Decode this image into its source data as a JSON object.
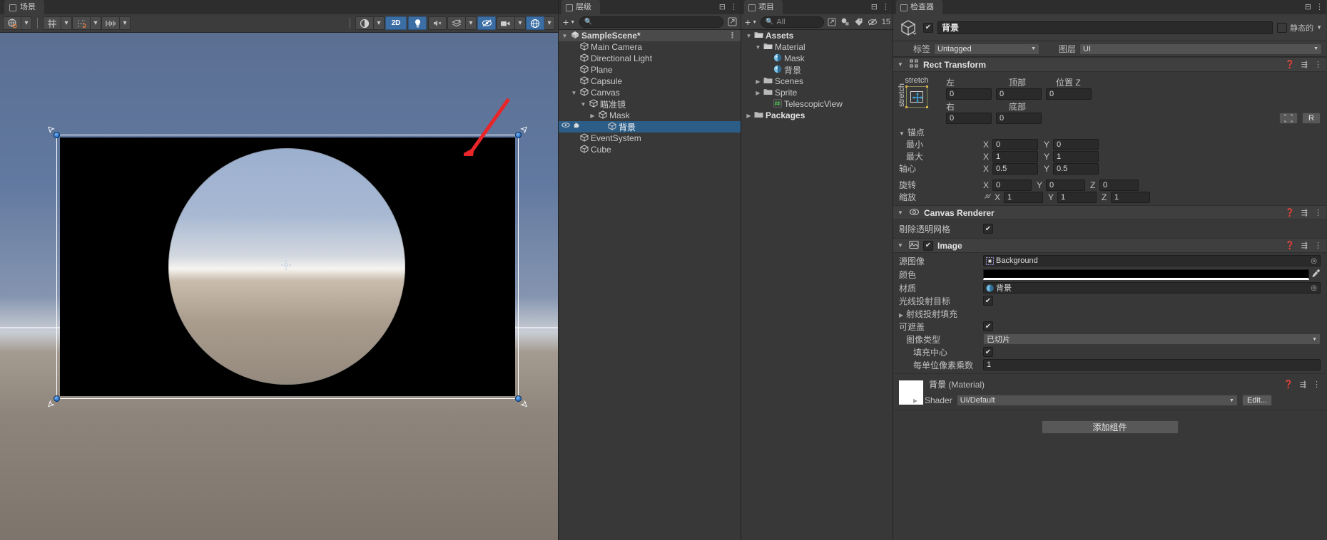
{
  "scene_view": {
    "tab_label": "场景",
    "toolbar_left": [
      {
        "name": "pivot-rotation-toggle",
        "glyph": "◍"
      },
      {
        "name": "pivot-rotation-caret",
        "glyph": "▾"
      },
      {
        "name": "grid-visibility-toggle",
        "glyph": "▦"
      },
      {
        "name": "grid-visibility-caret",
        "glyph": "▾"
      },
      {
        "name": "grid-snapping-toggle",
        "glyph": "⊞"
      },
      {
        "name": "grid-snapping-caret",
        "glyph": "▾"
      },
      {
        "name": "snap-increment-toggle",
        "glyph": "|||||"
      },
      {
        "name": "snap-increment-caret",
        "glyph": "▾"
      }
    ],
    "toolbar_right": [
      {
        "name": "shading-mode-button",
        "glyph": "◑",
        "active": false
      },
      {
        "name": "shading-mode-caret",
        "glyph": "▾",
        "active": false
      },
      {
        "name": "2d-toggle",
        "glyph": "2D",
        "active": true
      },
      {
        "name": "lighting-toggle",
        "glyph": "💡",
        "active": true
      },
      {
        "name": "audio-toggle",
        "glyph": "🔇",
        "active": false
      },
      {
        "name": "fx-toggle",
        "glyph": "≋",
        "active": false
      },
      {
        "name": "fx-caret",
        "glyph": "▾",
        "active": false
      },
      {
        "name": "scene-visibility-toggle",
        "glyph": "👁",
        "active": true
      },
      {
        "name": "camera-settings-button",
        "glyph": "🎥",
        "active": false
      },
      {
        "name": "camera-settings-caret",
        "glyph": "▾",
        "active": false
      },
      {
        "name": "gizmos-toggle",
        "glyph": "◉",
        "active": true
      },
      {
        "name": "gizmos-caret",
        "glyph": "▾",
        "active": false
      }
    ],
    "annotation": "red-arrow-pointing-to-rect-corner"
  },
  "hierarchy": {
    "tab_label": "层级",
    "search_placeholder": "",
    "add_button": "+",
    "scene_row": {
      "label": "SampleScene*",
      "icon": "unity-scene-icon",
      "expanded": true
    },
    "items": [
      {
        "label": "Main Camera",
        "indent": 1,
        "icon": "gameobject-icon",
        "arrow": "",
        "selected": false
      },
      {
        "label": "Directional Light",
        "indent": 1,
        "icon": "gameobject-icon",
        "arrow": "",
        "selected": false
      },
      {
        "label": "Plane",
        "indent": 1,
        "icon": "gameobject-icon",
        "arrow": "",
        "selected": false
      },
      {
        "label": "Capsule",
        "indent": 1,
        "icon": "gameobject-icon",
        "arrow": "",
        "selected": false
      },
      {
        "label": "Canvas",
        "indent": 1,
        "icon": "gameobject-icon",
        "arrow": "▼",
        "selected": false
      },
      {
        "label": "瞄准镜",
        "indent": 2,
        "icon": "gameobject-icon",
        "arrow": "▼",
        "selected": false
      },
      {
        "label": "Mask",
        "indent": 3,
        "icon": "gameobject-icon",
        "arrow": "▶",
        "selected": false
      },
      {
        "label": "背景",
        "indent": 4,
        "icon": "gameobject-icon",
        "arrow": "",
        "selected": true
      },
      {
        "label": "EventSystem",
        "indent": 1,
        "icon": "gameobject-icon",
        "arrow": "",
        "selected": false
      },
      {
        "label": "Cube",
        "indent": 1,
        "icon": "gameobject-icon",
        "arrow": "",
        "selected": false
      }
    ]
  },
  "project": {
    "tab_label": "项目",
    "search_placeholder": "All",
    "add_button": "+",
    "visible_count": "15",
    "items": [
      {
        "label": "Assets",
        "indent": 0,
        "icon": "folder-open-icon",
        "arrow": "▼",
        "bold": true
      },
      {
        "label": "Material",
        "indent": 1,
        "icon": "folder-open-icon",
        "arrow": "▼",
        "bold": false
      },
      {
        "label": "Mask",
        "indent": 2,
        "icon": "material-icon",
        "arrow": "",
        "bold": false
      },
      {
        "label": "背景",
        "indent": 2,
        "icon": "material-icon",
        "arrow": "",
        "bold": false
      },
      {
        "label": "Scenes",
        "indent": 1,
        "icon": "folder-icon",
        "arrow": "▶",
        "bold": false
      },
      {
        "label": "Sprite",
        "indent": 1,
        "icon": "folder-icon",
        "arrow": "▶",
        "bold": false
      },
      {
        "label": "TelescopicView",
        "indent": 2,
        "icon": "script-icon",
        "arrow": "",
        "bold": false
      },
      {
        "label": "Packages",
        "indent": 0,
        "icon": "folder-icon",
        "arrow": "▶",
        "bold": true
      }
    ]
  },
  "inspector": {
    "tab_label": "检查器",
    "object_name": "背景",
    "object_enabled": true,
    "static_label": "静态的",
    "static_checked": false,
    "tag_label": "标签",
    "tag_value": "Untagged",
    "layer_label": "图层",
    "layer_value": "UI",
    "rect_transform": {
      "title": "Rect Transform",
      "stretch_label_h": "stretch",
      "stretch_label_v": "stretch",
      "left_label": "左",
      "left_value": "0",
      "top_label": "顶部",
      "top_value": "0",
      "posz_label": "位置 Z",
      "posz_value": "0",
      "right_label": "右",
      "right_value": "0",
      "bottom_label": "底部",
      "bottom_value": "0",
      "blueprint_btn": "R",
      "anchors_label": "锚点",
      "min_label": "最小",
      "min_x": "0",
      "min_y": "0",
      "max_label": "最大",
      "max_x": "1",
      "max_y": "1",
      "pivot_label": "轴心",
      "pivot_x": "0.5",
      "pivot_y": "0.5",
      "rotation_label": "旋转",
      "rot_x": "0",
      "rot_y": "0",
      "rot_z": "0",
      "scale_label": "缩放",
      "scl_x": "1",
      "scl_y": "1",
      "scl_z": "1",
      "axis_x": "X",
      "axis_y": "Y",
      "axis_z": "Z"
    },
    "canvas_renderer": {
      "title": "Canvas Renderer",
      "cull_label": "剔除透明网格",
      "cull_checked": true
    },
    "image": {
      "title": "Image",
      "enabled": true,
      "source_label": "源图像",
      "source_value": "Background",
      "color_label": "颜色",
      "color_value": "#000000",
      "material_label": "材质",
      "material_value": "背景",
      "raycast_label": "光线投射目标",
      "raycast_checked": true,
      "raycast_padding_label": "射线投射填充",
      "maskable_label": "可遮盖",
      "maskable_checked": true,
      "image_type_label": "图像类型",
      "image_type_value": "已切片",
      "fill_center_label": "填充中心",
      "fill_center_checked": true,
      "ppu_label": "每单位像素乘数",
      "ppu_value": "1"
    },
    "material_preview": {
      "title": "背景",
      "subtitle": "(Material)",
      "shader_label": "Shader",
      "shader_value": "UI/Default",
      "edit_label": "Edit..."
    },
    "add_component_label": "添加组件",
    "annotation": "red-arrow-pointing-to-material-field"
  },
  "colors": {
    "selection_blue": "#2c5d87",
    "accent_blue": "#3b6ea5",
    "annotation_red": "#e8262a",
    "panel_bg": "#383838",
    "toolbar_bg": "#3c3c3c"
  }
}
